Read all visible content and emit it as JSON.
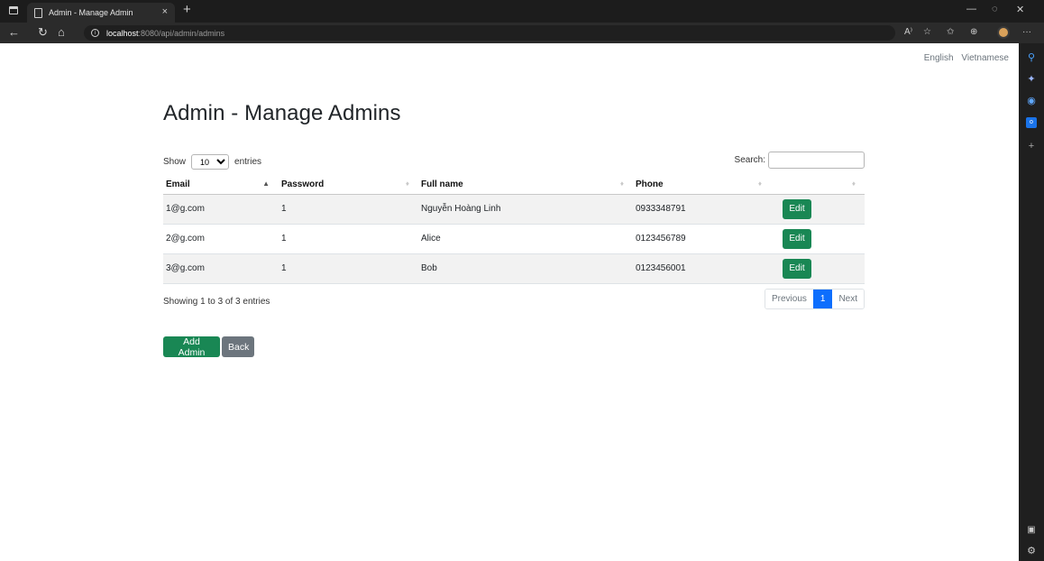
{
  "browser": {
    "tab_title": "Admin - Manage Admin",
    "tab_close": "×",
    "new_tab": "+",
    "url_host": "localhost",
    "url_path": ":8080/api/admin/admins",
    "info": "i",
    "nav": {
      "back": "←",
      "reload": "↻",
      "home": "⌂"
    },
    "window": {
      "minimize": "—",
      "restore": "◌",
      "close": "✕"
    },
    "toolbar": {
      "read_aloud": "A⁾",
      "favorite_add": "☆",
      "favorites": "✩",
      "collections": "⊕",
      "more": "···"
    }
  },
  "sidebar_icons": [
    "search-icon",
    "copilot-icon",
    "m365-icon",
    "outlook-icon",
    "add-icon",
    "layout-icon",
    "settings-icon"
  ],
  "language": {
    "english": "English",
    "vietnamese": "Vietnamese"
  },
  "page_title": "Admin - Manage Admins",
  "table_controls": {
    "show_label": "Show",
    "entries_label": "entries",
    "page_size": "10",
    "search_label": "Search:",
    "search_value": ""
  },
  "table": {
    "columns": [
      "Email",
      "Password",
      "Full name",
      "Phone",
      ""
    ],
    "rows": [
      {
        "email": "1@g.com",
        "password": "1",
        "full_name": "Nguyễn Hoàng Linh",
        "phone": "0933348791",
        "action": "Edit"
      },
      {
        "email": "2@g.com",
        "password": "1",
        "full_name": "Alice",
        "phone": "0123456789",
        "action": "Edit"
      },
      {
        "email": "3@g.com",
        "password": "1",
        "full_name": "Bob",
        "phone": "0123456001",
        "action": "Edit"
      }
    ]
  },
  "table_info": "Showing 1 to 3 of 3 entries",
  "pagination": {
    "previous": "Previous",
    "current": "1",
    "next": "Next"
  },
  "actions": {
    "add_admin": "Add Admin",
    "back": "Back"
  },
  "colors": {
    "success": "#198754",
    "secondary": "#6c757d",
    "primary": "#0d6efd"
  }
}
